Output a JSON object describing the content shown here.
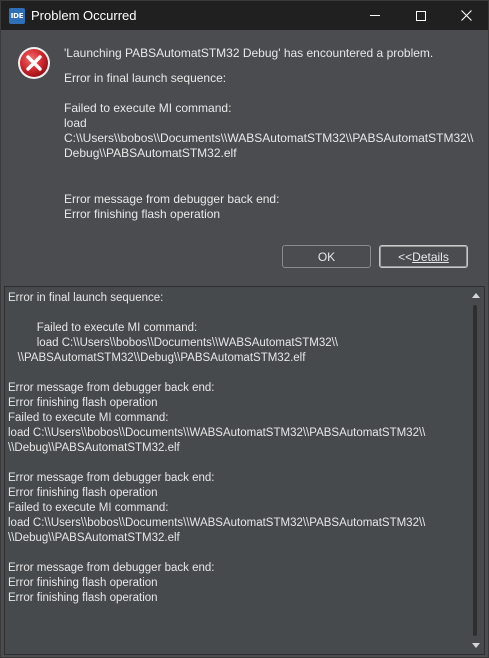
{
  "window": {
    "app_icon_text": "IDE",
    "title": "Problem Occurred"
  },
  "header": {
    "headline": "'Launching PABSAutomatSTM32 Debug' has encountered a problem.",
    "sub": "Error in final launch sequence:",
    "block": "Failed to execute MI command:\nload\nC:\\\\Users\\\\bobos\\\\Documents\\\\WABSAutomatSTM32\\\\PABSAutomatSTM32\\\\\nDebug\\\\PABSAutomatSTM32.elf",
    "block2": "Error message from debugger back end:\nError finishing flash operation"
  },
  "buttons": {
    "ok_label": "OK",
    "details_prefix": "<< ",
    "details_label": "Details"
  },
  "details": {
    "text": "Error in final launch sequence:\n\n         Failed to execute MI command:\n         load C:\\\\Users\\\\bobos\\\\Documents\\\\WABSAutomatSTM32\\\\\n   \\\\PABSAutomatSTM32\\\\Debug\\\\PABSAutomatSTM32.elf\n\nError message from debugger back end:\nError finishing flash operation\nFailed to execute MI command:\nload C:\\\\Users\\\\bobos\\\\Documents\\\\WABSAutomatSTM32\\\\PABSAutomatSTM32\\\\\n\\\\Debug\\\\PABSAutomatSTM32.elf\n\nError message from debugger back end:\nError finishing flash operation\nFailed to execute MI command:\nload C:\\\\Users\\\\bobos\\\\Documents\\\\WABSAutomatSTM32\\\\PABSAutomatSTM32\\\\\n\\\\Debug\\\\PABSAutomatSTM32.elf\n\nError message from debugger back end:\nError finishing flash operation\nError finishing flash operation"
  },
  "icons": {
    "app": "ide-icon",
    "error": "error-icon",
    "minimize": "minimize-icon",
    "maximize": "maximize-icon",
    "close": "close-icon"
  },
  "colors": {
    "background": "#4a4c4f",
    "titlebar": "#202020",
    "error_red": "#c8202a",
    "text": "#e6e6e6"
  }
}
